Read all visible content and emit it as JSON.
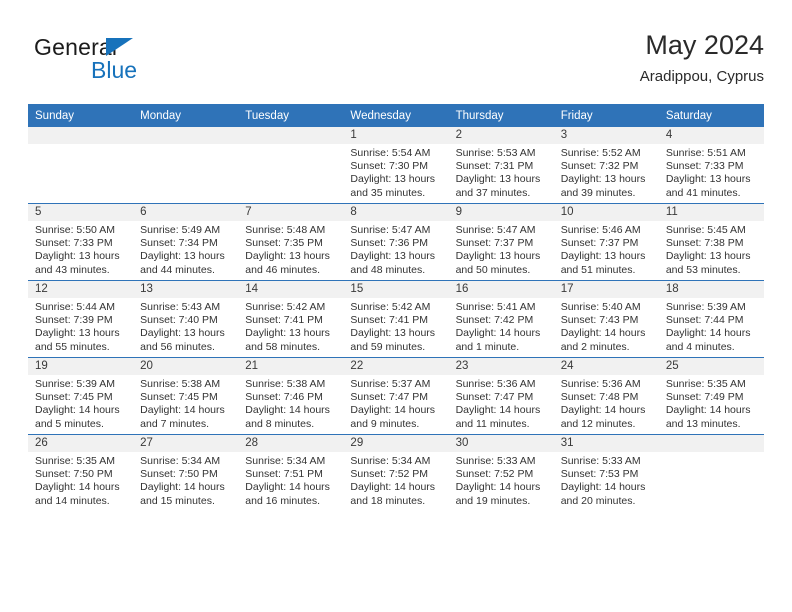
{
  "brand": {
    "line1": "General",
    "line2": "Blue",
    "accent_color": "#1772bb",
    "text_color": "#1b1b1b"
  },
  "header": {
    "title": "May 2024",
    "subtitle": "Aradippou, Cyprus"
  },
  "theme": {
    "header_blue": "#2f73b8",
    "daynum_bg": "#f1f1f1",
    "separator_blue": "#2f73b8",
    "body_text": "#333333"
  },
  "calendar": {
    "weekday_headers": [
      "Sunday",
      "Monday",
      "Tuesday",
      "Wednesday",
      "Thursday",
      "Friday",
      "Saturday"
    ],
    "labels": {
      "sunrise": "Sunrise:",
      "sunset": "Sunset:",
      "daylight": "Daylight:"
    },
    "weeks": [
      [
        {
          "day": "",
          "empty": true
        },
        {
          "day": "",
          "empty": true
        },
        {
          "day": "",
          "empty": true
        },
        {
          "day": "1",
          "sunrise": "Sunrise: 5:54 AM",
          "sunset": "Sunset: 7:30 PM",
          "daylight1": "Daylight: 13 hours",
          "daylight2": "and 35 minutes."
        },
        {
          "day": "2",
          "sunrise": "Sunrise: 5:53 AM",
          "sunset": "Sunset: 7:31 PM",
          "daylight1": "Daylight: 13 hours",
          "daylight2": "and 37 minutes."
        },
        {
          "day": "3",
          "sunrise": "Sunrise: 5:52 AM",
          "sunset": "Sunset: 7:32 PM",
          "daylight1": "Daylight: 13 hours",
          "daylight2": "and 39 minutes."
        },
        {
          "day": "4",
          "sunrise": "Sunrise: 5:51 AM",
          "sunset": "Sunset: 7:33 PM",
          "daylight1": "Daylight: 13 hours",
          "daylight2": "and 41 minutes."
        }
      ],
      [
        {
          "day": "5",
          "sunrise": "Sunrise: 5:50 AM",
          "sunset": "Sunset: 7:33 PM",
          "daylight1": "Daylight: 13 hours",
          "daylight2": "and 43 minutes."
        },
        {
          "day": "6",
          "sunrise": "Sunrise: 5:49 AM",
          "sunset": "Sunset: 7:34 PM",
          "daylight1": "Daylight: 13 hours",
          "daylight2": "and 44 minutes."
        },
        {
          "day": "7",
          "sunrise": "Sunrise: 5:48 AM",
          "sunset": "Sunset: 7:35 PM",
          "daylight1": "Daylight: 13 hours",
          "daylight2": "and 46 minutes."
        },
        {
          "day": "8",
          "sunrise": "Sunrise: 5:47 AM",
          "sunset": "Sunset: 7:36 PM",
          "daylight1": "Daylight: 13 hours",
          "daylight2": "and 48 minutes."
        },
        {
          "day": "9",
          "sunrise": "Sunrise: 5:47 AM",
          "sunset": "Sunset: 7:37 PM",
          "daylight1": "Daylight: 13 hours",
          "daylight2": "and 50 minutes."
        },
        {
          "day": "10",
          "sunrise": "Sunrise: 5:46 AM",
          "sunset": "Sunset: 7:37 PM",
          "daylight1": "Daylight: 13 hours",
          "daylight2": "and 51 minutes."
        },
        {
          "day": "11",
          "sunrise": "Sunrise: 5:45 AM",
          "sunset": "Sunset: 7:38 PM",
          "daylight1": "Daylight: 13 hours",
          "daylight2": "and 53 minutes."
        }
      ],
      [
        {
          "day": "12",
          "sunrise": "Sunrise: 5:44 AM",
          "sunset": "Sunset: 7:39 PM",
          "daylight1": "Daylight: 13 hours",
          "daylight2": "and 55 minutes."
        },
        {
          "day": "13",
          "sunrise": "Sunrise: 5:43 AM",
          "sunset": "Sunset: 7:40 PM",
          "daylight1": "Daylight: 13 hours",
          "daylight2": "and 56 minutes."
        },
        {
          "day": "14",
          "sunrise": "Sunrise: 5:42 AM",
          "sunset": "Sunset: 7:41 PM",
          "daylight1": "Daylight: 13 hours",
          "daylight2": "and 58 minutes."
        },
        {
          "day": "15",
          "sunrise": "Sunrise: 5:42 AM",
          "sunset": "Sunset: 7:41 PM",
          "daylight1": "Daylight: 13 hours",
          "daylight2": "and 59 minutes."
        },
        {
          "day": "16",
          "sunrise": "Sunrise: 5:41 AM",
          "sunset": "Sunset: 7:42 PM",
          "daylight1": "Daylight: 14 hours",
          "daylight2": "and 1 minute."
        },
        {
          "day": "17",
          "sunrise": "Sunrise: 5:40 AM",
          "sunset": "Sunset: 7:43 PM",
          "daylight1": "Daylight: 14 hours",
          "daylight2": "and 2 minutes."
        },
        {
          "day": "18",
          "sunrise": "Sunrise: 5:39 AM",
          "sunset": "Sunset: 7:44 PM",
          "daylight1": "Daylight: 14 hours",
          "daylight2": "and 4 minutes."
        }
      ],
      [
        {
          "day": "19",
          "sunrise": "Sunrise: 5:39 AM",
          "sunset": "Sunset: 7:45 PM",
          "daylight1": "Daylight: 14 hours",
          "daylight2": "and 5 minutes."
        },
        {
          "day": "20",
          "sunrise": "Sunrise: 5:38 AM",
          "sunset": "Sunset: 7:45 PM",
          "daylight1": "Daylight: 14 hours",
          "daylight2": "and 7 minutes."
        },
        {
          "day": "21",
          "sunrise": "Sunrise: 5:38 AM",
          "sunset": "Sunset: 7:46 PM",
          "daylight1": "Daylight: 14 hours",
          "daylight2": "and 8 minutes."
        },
        {
          "day": "22",
          "sunrise": "Sunrise: 5:37 AM",
          "sunset": "Sunset: 7:47 PM",
          "daylight1": "Daylight: 14 hours",
          "daylight2": "and 9 minutes."
        },
        {
          "day": "23",
          "sunrise": "Sunrise: 5:36 AM",
          "sunset": "Sunset: 7:47 PM",
          "daylight1": "Daylight: 14 hours",
          "daylight2": "and 11 minutes."
        },
        {
          "day": "24",
          "sunrise": "Sunrise: 5:36 AM",
          "sunset": "Sunset: 7:48 PM",
          "daylight1": "Daylight: 14 hours",
          "daylight2": "and 12 minutes."
        },
        {
          "day": "25",
          "sunrise": "Sunrise: 5:35 AM",
          "sunset": "Sunset: 7:49 PM",
          "daylight1": "Daylight: 14 hours",
          "daylight2": "and 13 minutes."
        }
      ],
      [
        {
          "day": "26",
          "sunrise": "Sunrise: 5:35 AM",
          "sunset": "Sunset: 7:50 PM",
          "daylight1": "Daylight: 14 hours",
          "daylight2": "and 14 minutes."
        },
        {
          "day": "27",
          "sunrise": "Sunrise: 5:34 AM",
          "sunset": "Sunset: 7:50 PM",
          "daylight1": "Daylight: 14 hours",
          "daylight2": "and 15 minutes."
        },
        {
          "day": "28",
          "sunrise": "Sunrise: 5:34 AM",
          "sunset": "Sunset: 7:51 PM",
          "daylight1": "Daylight: 14 hours",
          "daylight2": "and 16 minutes."
        },
        {
          "day": "29",
          "sunrise": "Sunrise: 5:34 AM",
          "sunset": "Sunset: 7:52 PM",
          "daylight1": "Daylight: 14 hours",
          "daylight2": "and 18 minutes."
        },
        {
          "day": "30",
          "sunrise": "Sunrise: 5:33 AM",
          "sunset": "Sunset: 7:52 PM",
          "daylight1": "Daylight: 14 hours",
          "daylight2": "and 19 minutes."
        },
        {
          "day": "31",
          "sunrise": "Sunrise: 5:33 AM",
          "sunset": "Sunset: 7:53 PM",
          "daylight1": "Daylight: 14 hours",
          "daylight2": "and 20 minutes."
        },
        {
          "day": "",
          "empty": true
        }
      ]
    ]
  }
}
